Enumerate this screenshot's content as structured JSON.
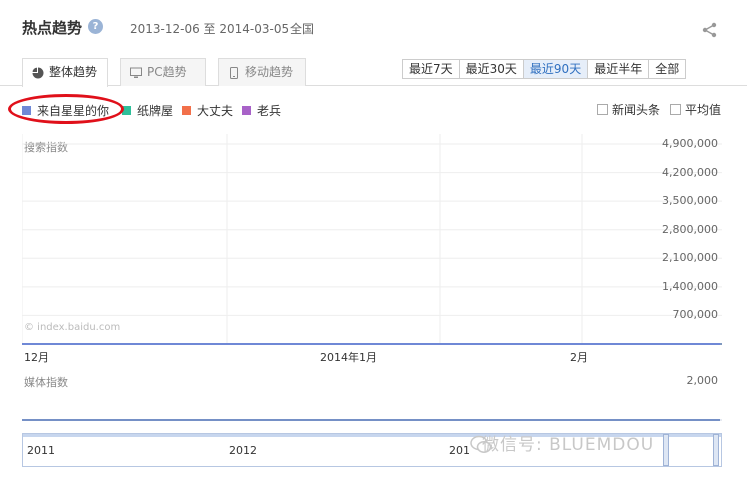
{
  "header": {
    "title": "热点趋势",
    "help": "?",
    "date_range": "2013-12-06 至 2014-03-05",
    "region": "全国"
  },
  "tabs": [
    {
      "label": "整体趋势",
      "icon": "pie-icon",
      "active": true
    },
    {
      "label": "PC趋势",
      "icon": "monitor-icon",
      "active": false
    },
    {
      "label": "移动趋势",
      "icon": "phone-icon",
      "active": false
    }
  ],
  "ranges": [
    {
      "label": "最近7天",
      "active": false
    },
    {
      "label": "最近30天",
      "active": false
    },
    {
      "label": "最近90天",
      "active": true
    },
    {
      "label": "最近半年",
      "active": false
    },
    {
      "label": "全部",
      "active": false
    }
  ],
  "legend": [
    {
      "label": "来自星星的你",
      "color": "#6f88d6"
    },
    {
      "label": "纸牌屋",
      "color": "#2fbf9a"
    },
    {
      "label": "大丈夫",
      "color": "#f2704a"
    },
    {
      "label": "老兵",
      "color": "#a862c8"
    }
  ],
  "options": {
    "news_headlines": "新闻头条",
    "average": "平均值"
  },
  "main_panel": {
    "label": "搜索指数",
    "source": "© index.baidu.com",
    "x_labels": [
      "12月",
      "2014年1月",
      "2月"
    ],
    "y_labels": [
      "4,900,000",
      "4,200,000",
      "3,500,000",
      "2,800,000",
      "2,100,000",
      "1,400,000",
      "700,000"
    ]
  },
  "media_panel": {
    "label": "媒体指数",
    "y_label": "2,000"
  },
  "navigator": {
    "labels": [
      "2011",
      "2012",
      "201"
    ]
  },
  "watermark": "微信号: BLUEMDOU",
  "chart_data": [
    {
      "type": "line",
      "title": "搜索指数",
      "x": [
        "2013-12-06",
        "2013-12-08",
        "2013-12-10",
        "2013-12-12",
        "2013-12-14",
        "2013-12-16",
        "2013-12-18",
        "2013-12-20",
        "2013-12-22",
        "2013-12-24",
        "2013-12-26",
        "2013-12-28",
        "2013-12-30",
        "2014-01-01",
        "2014-01-03",
        "2014-01-05",
        "2014-01-07",
        "2014-01-09",
        "2014-01-11",
        "2014-01-13",
        "2014-01-15",
        "2014-01-17",
        "2014-01-19",
        "2014-01-21",
        "2014-01-23",
        "2014-01-25",
        "2014-01-27",
        "2014-01-29",
        "2014-01-31",
        "2014-02-02",
        "2014-02-04",
        "2014-02-06",
        "2014-02-08",
        "2014-02-10",
        "2014-02-12",
        "2014-02-14",
        "2014-02-16",
        "2014-02-18",
        "2014-02-20",
        "2014-02-22",
        "2014-02-24",
        "2014-02-26",
        "2014-02-28",
        "2014-03-02",
        "2014-03-04",
        "2014-03-05"
      ],
      "ylim": [
        0,
        4900000
      ],
      "y_ticks": [
        700000,
        1400000,
        2100000,
        2800000,
        3500000,
        4200000,
        4900000
      ],
      "series": [
        {
          "name": "来自星星的你",
          "values": [
            0,
            0,
            0,
            0,
            0,
            0,
            0,
            0,
            0,
            0,
            0,
            0,
            0,
            0,
            0,
            0,
            0,
            0,
            0,
            0,
            0,
            0,
            0,
            0,
            0,
            0,
            0,
            0,
            0,
            0,
            0,
            0,
            0,
            0,
            0,
            0,
            0,
            0,
            0,
            0,
            0,
            0,
            0,
            0,
            0,
            0
          ]
        },
        {
          "name": "纸牌屋",
          "values": [
            0,
            0,
            0,
            0,
            0,
            0,
            0,
            0,
            0,
            0,
            0,
            0,
            0,
            0,
            0,
            0,
            0,
            0,
            0,
            0,
            0,
            0,
            0,
            0,
            0,
            0,
            0,
            0,
            0,
            0,
            0,
            0,
            0,
            0,
            0,
            0,
            0,
            0,
            0,
            0,
            0,
            0,
            0,
            0,
            0,
            0
          ]
        },
        {
          "name": "大丈夫",
          "values": [
            0,
            0,
            0,
            0,
            0,
            0,
            0,
            0,
            0,
            0,
            0,
            0,
            0,
            0,
            0,
            0,
            0,
            0,
            0,
            0,
            0,
            0,
            0,
            0,
            0,
            0,
            0,
            0,
            0,
            0,
            0,
            0,
            0,
            0,
            0,
            0,
            0,
            0,
            0,
            0,
            0,
            0,
            0,
            0,
            0,
            0
          ]
        },
        {
          "name": "老兵",
          "values": [
            0,
            0,
            0,
            0,
            0,
            0,
            0,
            0,
            0,
            0,
            0,
            0,
            0,
            0,
            0,
            0,
            0,
            0,
            0,
            0,
            0,
            0,
            0,
            0,
            0,
            0,
            0,
            0,
            0,
            0,
            0,
            0,
            0,
            0,
            0,
            0,
            0,
            0,
            0,
            0,
            0,
            0,
            0,
            0,
            0,
            0
          ]
        }
      ],
      "grid": true
    },
    {
      "type": "area",
      "title": "媒体指数",
      "ylim": [
        0,
        2000
      ],
      "series": [
        {
          "name": "来自星星的你",
          "values": [
            0,
            0,
            0,
            0,
            0,
            0,
            0,
            0,
            0,
            0,
            0,
            0,
            0,
            0,
            0,
            0,
            0,
            0,
            0,
            0,
            0,
            0,
            0,
            0,
            0,
            0,
            0,
            0,
            0,
            0,
            0,
            0,
            0,
            0,
            0,
            0,
            0,
            0,
            0,
            0,
            0,
            0,
            0,
            0,
            0,
            0
          ]
        },
        {
          "name": "纸牌屋",
          "values": [
            0,
            0,
            0,
            0,
            0,
            0,
            0,
            0,
            0,
            0,
            0,
            0,
            0,
            0,
            0,
            0,
            0,
            0,
            0,
            0,
            0,
            0,
            0,
            0,
            0,
            0,
            0,
            0,
            0,
            0,
            0,
            0,
            0,
            0,
            0,
            0,
            0,
            0,
            0,
            0,
            0,
            0,
            0,
            0,
            0,
            0
          ]
        },
        {
          "name": "大丈夫",
          "values": [
            0,
            0,
            0,
            0,
            0,
            0,
            0,
            0,
            0,
            0,
            0,
            0,
            0,
            0,
            0,
            0,
            0,
            0,
            0,
            0,
            0,
            0,
            0,
            0,
            0,
            0,
            0,
            0,
            0,
            0,
            0,
            0,
            0,
            0,
            0,
            0,
            0,
            0,
            0,
            0,
            0,
            0,
            0,
            0,
            0,
            0
          ]
        },
        {
          "name": "老兵",
          "values": [
            0,
            0,
            0,
            0,
            0,
            0,
            0,
            0,
            0,
            0,
            0,
            0,
            0,
            0,
            0,
            0,
            0,
            0,
            0,
            0,
            0,
            0,
            0,
            0,
            0,
            0,
            0,
            0,
            0,
            0,
            0,
            0,
            0,
            0,
            0,
            0,
            0,
            0,
            0,
            0,
            0,
            0,
            0,
            0,
            0,
            0
          ]
        }
      ]
    }
  ]
}
